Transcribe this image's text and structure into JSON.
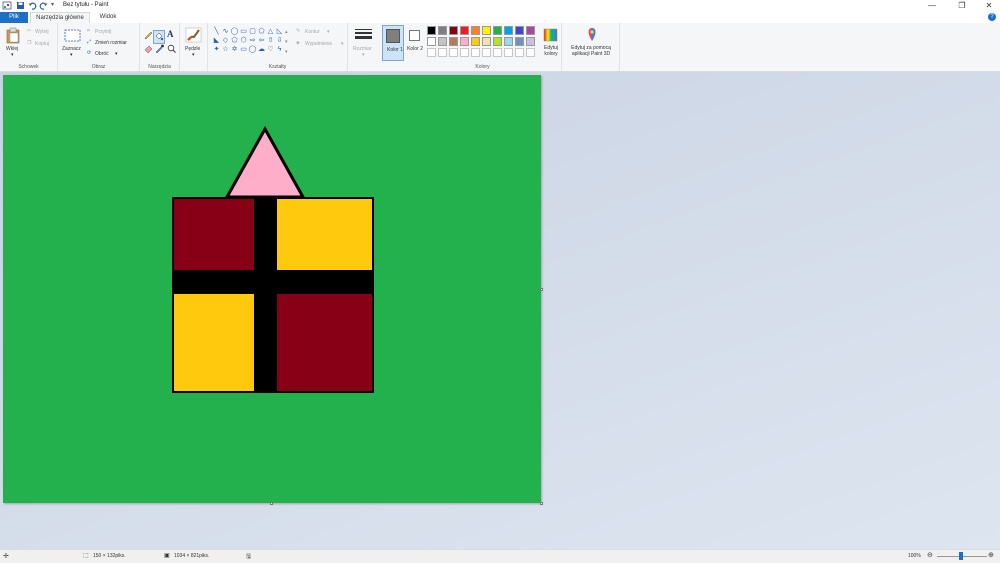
{
  "window": {
    "title": "Bez tytułu - Paint",
    "minimize_glyph": "—",
    "restore_glyph": "❐",
    "close_glyph": "✕"
  },
  "tabs": [
    {
      "label": "Plik"
    },
    {
      "label": "Narzędzia główne"
    },
    {
      "label": "Widok"
    }
  ],
  "ribbon": {
    "clipboard": {
      "label": "Schowek",
      "paste": "Wklej",
      "cut": "Wytnij",
      "copy": "Kopiuj"
    },
    "image": {
      "label": "Obraz",
      "select": "Zaznacz",
      "crop": "Przytnij",
      "resize": "Zmień rozmiar",
      "rotate": "Obróć"
    },
    "tools": {
      "label": "Narzędzia",
      "text_glyph": "A"
    },
    "brushes": {
      "label": "Pędzle"
    },
    "shapes": {
      "label": "Kształty",
      "outline": "Kontur",
      "fill": "Wypełnienie"
    },
    "size": {
      "label": "Rozmiar"
    },
    "color1": {
      "label": "Kolor 1",
      "value": "#7f7f7f"
    },
    "color2": {
      "label": "Kolor 2",
      "value": "#ffffff"
    },
    "colors": {
      "label": "Kolory",
      "row1": [
        "#000000",
        "#7f7f7f",
        "#880015",
        "#ed1c24",
        "#ff7f27",
        "#fff200",
        "#22b14c",
        "#00a2e8",
        "#3f48cc",
        "#a349a4"
      ],
      "row2": [
        "#ffffff",
        "#c3c3c3",
        "#b97a57",
        "#ffaec9",
        "#ffc90e",
        "#efe4b0",
        "#b5e61d",
        "#99d9ea",
        "#7092be",
        "#c8bfe7"
      ],
      "row3": [
        "#ffffff",
        "#ffffff",
        "#ffffff",
        "#ffffff",
        "#ffffff",
        "#ffffff",
        "#ffffff",
        "#ffffff",
        "#ffffff",
        "#ffffff"
      ]
    },
    "edit_colors": "Edytuj kolory",
    "paint3d": "Edytuj za pomocą aplikacji Paint 3D"
  },
  "drawing": {
    "background": "#22b14c",
    "triangle_color": "#ffaec9",
    "dark_red": "#880015",
    "yellow": "#ffc90e",
    "black": "#000000"
  },
  "status": {
    "selection_size": "150 × 132piks.",
    "image_size": "1034 × 821piks.",
    "zoom": "100%"
  }
}
